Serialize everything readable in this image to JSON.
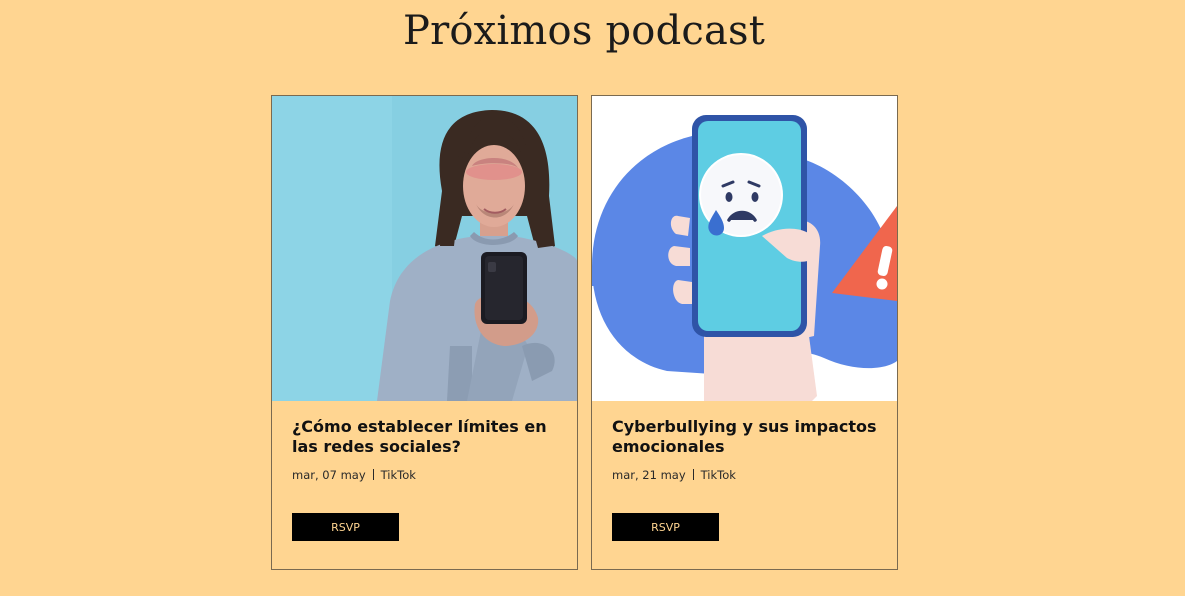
{
  "page": {
    "title": "Próximos podcast"
  },
  "events": [
    {
      "title": "¿Cómo establecer límites en las redes sociales?",
      "date": "mar, 07 may",
      "location": "TikTok",
      "button_label": "RSVP",
      "image_icon": "man-with-phone-photo"
    },
    {
      "title": "Cyberbullying y sus impactos emocionales",
      "date": "mar, 21 may",
      "location": "TikTok",
      "button_label": "RSVP",
      "image_icon": "sad-phone-illustration"
    }
  ],
  "colors": {
    "background": "#FFD591",
    "button_bg": "#000000",
    "button_text": "#FFD591"
  }
}
